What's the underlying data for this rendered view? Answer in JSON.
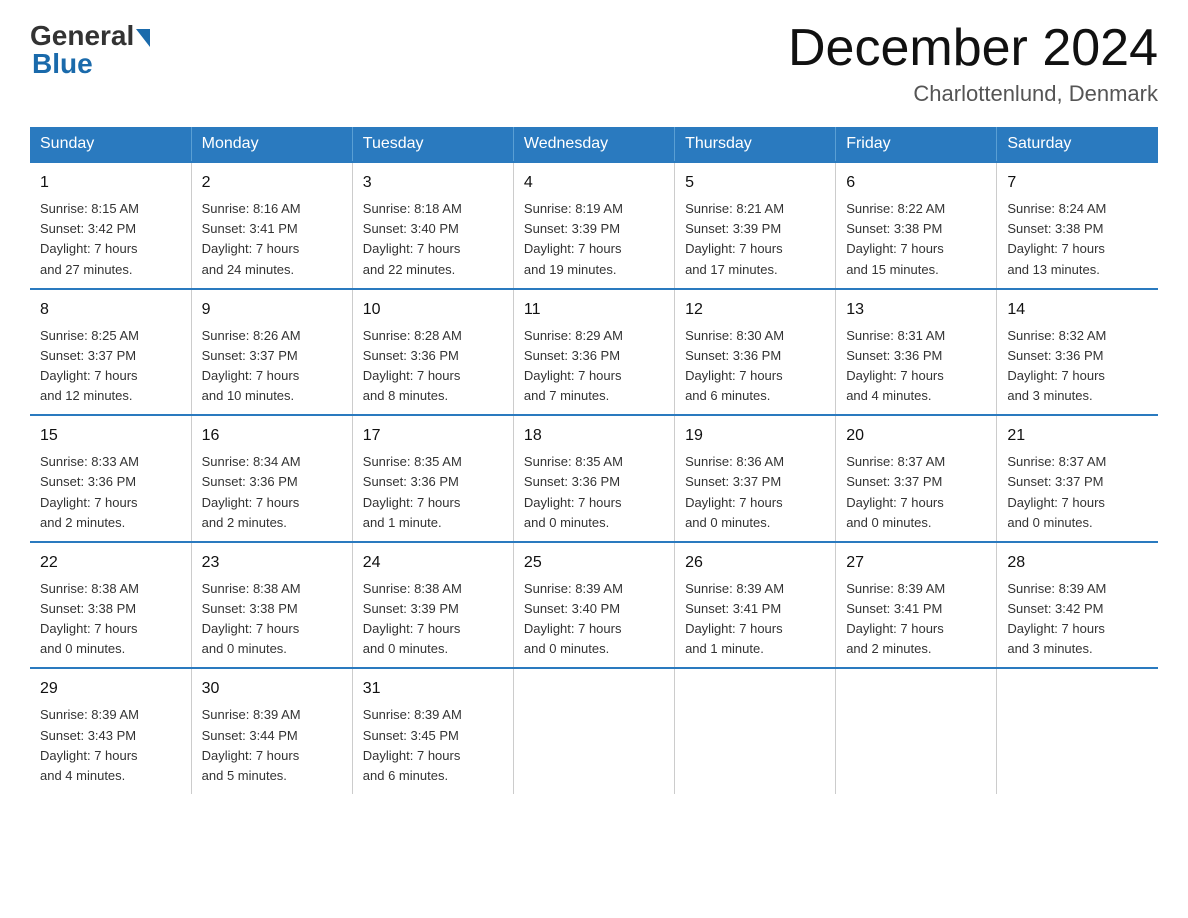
{
  "header": {
    "logo_general": "General",
    "logo_blue": "Blue",
    "month_title": "December 2024",
    "location": "Charlottenlund, Denmark"
  },
  "weekdays": [
    "Sunday",
    "Monday",
    "Tuesday",
    "Wednesday",
    "Thursday",
    "Friday",
    "Saturday"
  ],
  "weeks": [
    [
      {
        "day": "1",
        "sunrise": "8:15 AM",
        "sunset": "3:42 PM",
        "daylight": "7 hours and 27 minutes."
      },
      {
        "day": "2",
        "sunrise": "8:16 AM",
        "sunset": "3:41 PM",
        "daylight": "7 hours and 24 minutes."
      },
      {
        "day": "3",
        "sunrise": "8:18 AM",
        "sunset": "3:40 PM",
        "daylight": "7 hours and 22 minutes."
      },
      {
        "day": "4",
        "sunrise": "8:19 AM",
        "sunset": "3:39 PM",
        "daylight": "7 hours and 19 minutes."
      },
      {
        "day": "5",
        "sunrise": "8:21 AM",
        "sunset": "3:39 PM",
        "daylight": "7 hours and 17 minutes."
      },
      {
        "day": "6",
        "sunrise": "8:22 AM",
        "sunset": "3:38 PM",
        "daylight": "7 hours and 15 minutes."
      },
      {
        "day": "7",
        "sunrise": "8:24 AM",
        "sunset": "3:38 PM",
        "daylight": "7 hours and 13 minutes."
      }
    ],
    [
      {
        "day": "8",
        "sunrise": "8:25 AM",
        "sunset": "3:37 PM",
        "daylight": "7 hours and 12 minutes."
      },
      {
        "day": "9",
        "sunrise": "8:26 AM",
        "sunset": "3:37 PM",
        "daylight": "7 hours and 10 minutes."
      },
      {
        "day": "10",
        "sunrise": "8:28 AM",
        "sunset": "3:36 PM",
        "daylight": "7 hours and 8 minutes."
      },
      {
        "day": "11",
        "sunrise": "8:29 AM",
        "sunset": "3:36 PM",
        "daylight": "7 hours and 7 minutes."
      },
      {
        "day": "12",
        "sunrise": "8:30 AM",
        "sunset": "3:36 PM",
        "daylight": "7 hours and 6 minutes."
      },
      {
        "day": "13",
        "sunrise": "8:31 AM",
        "sunset": "3:36 PM",
        "daylight": "7 hours and 4 minutes."
      },
      {
        "day": "14",
        "sunrise": "8:32 AM",
        "sunset": "3:36 PM",
        "daylight": "7 hours and 3 minutes."
      }
    ],
    [
      {
        "day": "15",
        "sunrise": "8:33 AM",
        "sunset": "3:36 PM",
        "daylight": "7 hours and 2 minutes."
      },
      {
        "day": "16",
        "sunrise": "8:34 AM",
        "sunset": "3:36 PM",
        "daylight": "7 hours and 2 minutes."
      },
      {
        "day": "17",
        "sunrise": "8:35 AM",
        "sunset": "3:36 PM",
        "daylight": "7 hours and 1 minute."
      },
      {
        "day": "18",
        "sunrise": "8:35 AM",
        "sunset": "3:36 PM",
        "daylight": "7 hours and 0 minutes."
      },
      {
        "day": "19",
        "sunrise": "8:36 AM",
        "sunset": "3:37 PM",
        "daylight": "7 hours and 0 minutes."
      },
      {
        "day": "20",
        "sunrise": "8:37 AM",
        "sunset": "3:37 PM",
        "daylight": "7 hours and 0 minutes."
      },
      {
        "day": "21",
        "sunrise": "8:37 AM",
        "sunset": "3:37 PM",
        "daylight": "7 hours and 0 minutes."
      }
    ],
    [
      {
        "day": "22",
        "sunrise": "8:38 AM",
        "sunset": "3:38 PM",
        "daylight": "7 hours and 0 minutes."
      },
      {
        "day": "23",
        "sunrise": "8:38 AM",
        "sunset": "3:38 PM",
        "daylight": "7 hours and 0 minutes."
      },
      {
        "day": "24",
        "sunrise": "8:38 AM",
        "sunset": "3:39 PM",
        "daylight": "7 hours and 0 minutes."
      },
      {
        "day": "25",
        "sunrise": "8:39 AM",
        "sunset": "3:40 PM",
        "daylight": "7 hours and 0 minutes."
      },
      {
        "day": "26",
        "sunrise": "8:39 AM",
        "sunset": "3:41 PM",
        "daylight": "7 hours and 1 minute."
      },
      {
        "day": "27",
        "sunrise": "8:39 AM",
        "sunset": "3:41 PM",
        "daylight": "7 hours and 2 minutes."
      },
      {
        "day": "28",
        "sunrise": "8:39 AM",
        "sunset": "3:42 PM",
        "daylight": "7 hours and 3 minutes."
      }
    ],
    [
      {
        "day": "29",
        "sunrise": "8:39 AM",
        "sunset": "3:43 PM",
        "daylight": "7 hours and 4 minutes."
      },
      {
        "day": "30",
        "sunrise": "8:39 AM",
        "sunset": "3:44 PM",
        "daylight": "7 hours and 5 minutes."
      },
      {
        "day": "31",
        "sunrise": "8:39 AM",
        "sunset": "3:45 PM",
        "daylight": "7 hours and 6 minutes."
      },
      null,
      null,
      null,
      null
    ]
  ],
  "labels": {
    "sunrise": "Sunrise:",
    "sunset": "Sunset:",
    "daylight": "Daylight:"
  }
}
